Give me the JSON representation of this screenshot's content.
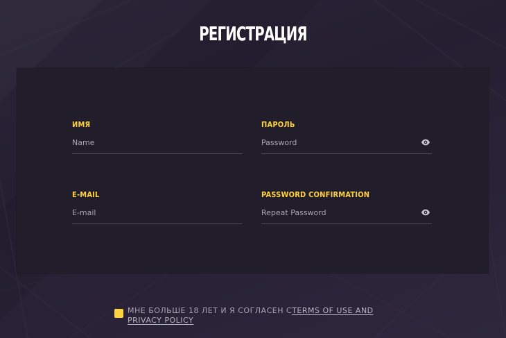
{
  "page": {
    "title": "РЕГИСТРАЦИЯ"
  },
  "form": {
    "name": {
      "label": "ИМЯ",
      "placeholder": "Name",
      "value": ""
    },
    "password": {
      "label": "ПАРОЛЬ",
      "placeholder": "Password",
      "value": "",
      "icon": "eye-icon"
    },
    "email": {
      "label": "E-MAIL",
      "placeholder": "E-mail",
      "value": ""
    },
    "password_confirmation": {
      "label": "PASSWORD CONFIRMATION",
      "placeholder": "Repeat Password",
      "value": "",
      "icon": "eye-icon"
    }
  },
  "consent": {
    "text": "МНЕ БОЛЬШЕ 18 ЛЕТ И Я СОГЛАСЕН С",
    "link": "TERMS OF USE AND PRIVACY POLICY",
    "checked": true
  },
  "colors": {
    "accent": "#ffd23f",
    "panel": "#211d2b",
    "background": "#2b2538",
    "text": "#ffffff",
    "muted": "#aaa6b2"
  }
}
